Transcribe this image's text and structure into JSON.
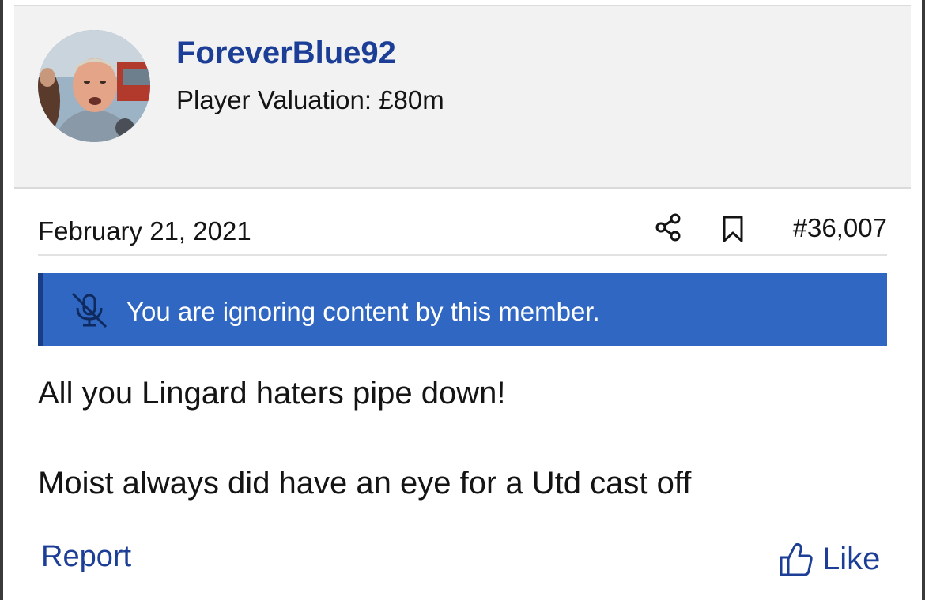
{
  "post": {
    "author": {
      "username": "ForeverBlue92",
      "subtitle": "Player Valuation: £80m",
      "avatar": "user-avatar-photo"
    },
    "date": "February 21, 2021",
    "number": "#36,007",
    "actions": {
      "share_icon": "share-icon",
      "bookmark_icon": "bookmark-icon"
    },
    "ignore_notice": {
      "icon": "muted-microphone-icon",
      "text": "You are ignoring content by this member."
    },
    "body": {
      "line1": "All you Lingard haters pipe down!",
      "line2": "Moist always did have an eye for a Utd cast off"
    },
    "footer": {
      "report_label": "Report",
      "like_label": "Like",
      "like_icon": "thumbs-up-icon"
    }
  },
  "colors": {
    "brand_blue": "#1c3e96",
    "notice_bar": "#2f67c2",
    "notice_border": "#1a3e86",
    "header_bg": "#f2f2f2"
  }
}
